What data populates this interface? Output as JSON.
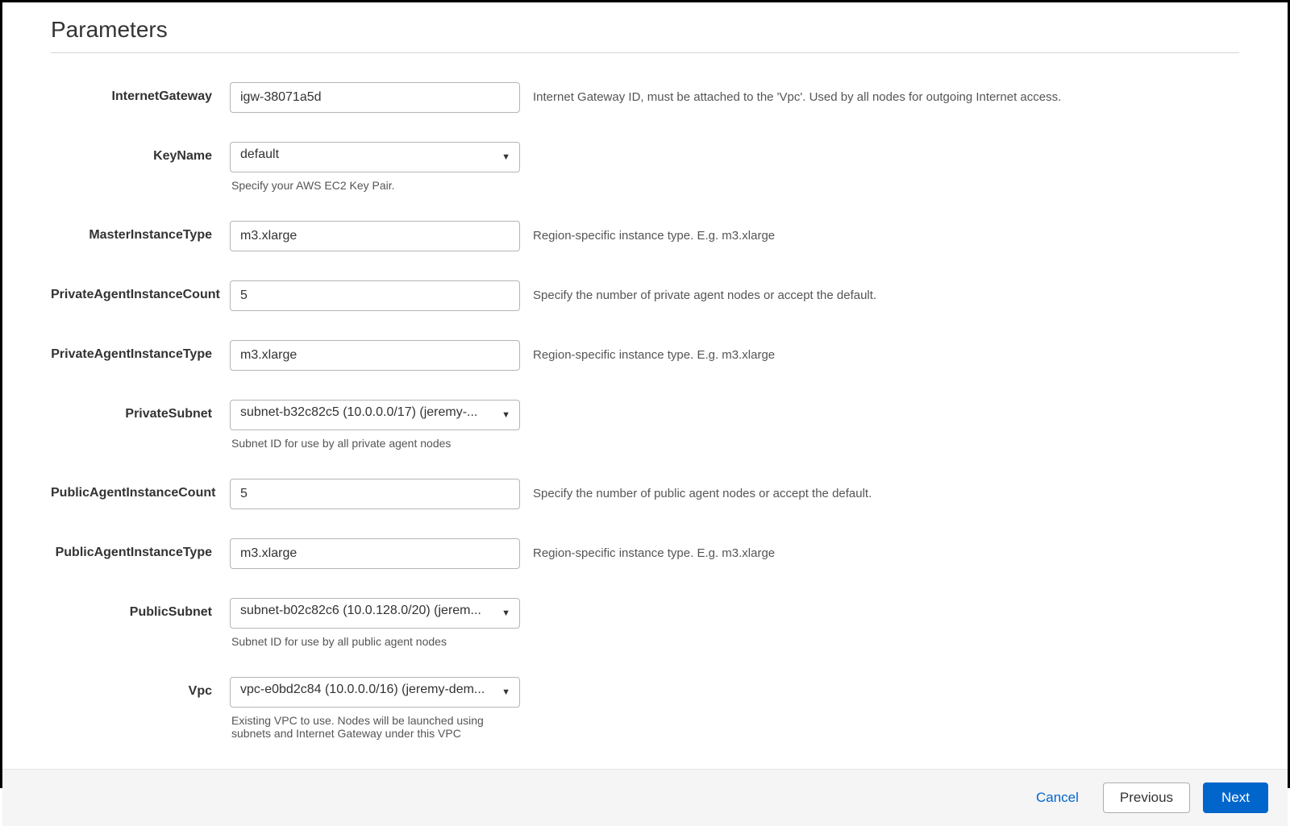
{
  "title": "Parameters",
  "fields": {
    "internetGateway": {
      "label": "InternetGateway",
      "value": "igw-38071a5d",
      "desc": "Internet Gateway ID, must be attached to the 'Vpc'. Used by all nodes for outgoing Internet access."
    },
    "keyName": {
      "label": "KeyName",
      "value": "default",
      "help": "Specify your AWS EC2 Key Pair."
    },
    "masterInstanceType": {
      "label": "MasterInstanceType",
      "value": "m3.xlarge",
      "desc": "Region-specific instance type. E.g. m3.xlarge"
    },
    "privateAgentInstanceCount": {
      "label": "PrivateAgentInstanceCount",
      "value": "5",
      "desc": "Specify the number of private agent nodes or accept the default."
    },
    "privateAgentInstanceType": {
      "label": "PrivateAgentInstanceType",
      "value": "m3.xlarge",
      "desc": "Region-specific instance type. E.g. m3.xlarge"
    },
    "privateSubnet": {
      "label": "PrivateSubnet",
      "value": "subnet-b32c82c5 (10.0.0.0/17) (jeremy-...",
      "help": "Subnet ID for use by all private agent nodes"
    },
    "publicAgentInstanceCount": {
      "label": "PublicAgentInstanceCount",
      "value": "5",
      "desc": "Specify the number of public agent nodes or accept the default."
    },
    "publicAgentInstanceType": {
      "label": "PublicAgentInstanceType",
      "value": "m3.xlarge",
      "desc": "Region-specific instance type. E.g. m3.xlarge"
    },
    "publicSubnet": {
      "label": "PublicSubnet",
      "value": "subnet-b02c82c6 (10.0.128.0/20) (jerem...",
      "help": "Subnet ID for use by all public agent nodes"
    },
    "vpc": {
      "label": "Vpc",
      "value": "vpc-e0bd2c84 (10.0.0.0/16) (jeremy-dem...",
      "help": "Existing VPC to use. Nodes will be launched using subnets and Internet Gateway under this VPC"
    }
  },
  "footer": {
    "cancel": "Cancel",
    "previous": "Previous",
    "next": "Next"
  }
}
